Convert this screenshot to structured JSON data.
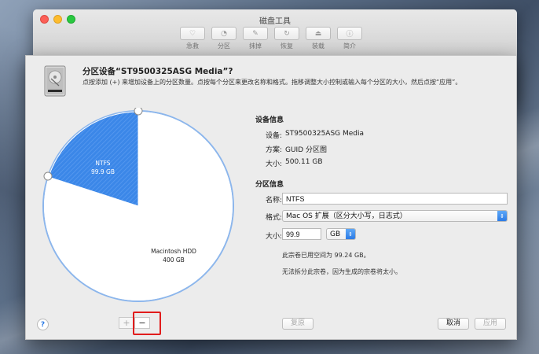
{
  "window": {
    "title": "磁盘工具",
    "toolbar": [
      {
        "label": "急救",
        "icon": "stethoscope-icon",
        "glyph": "♡"
      },
      {
        "label": "分区",
        "icon": "partition-icon",
        "glyph": "◔"
      },
      {
        "label": "抹掉",
        "icon": "erase-icon",
        "glyph": "✎"
      },
      {
        "label": "恢复",
        "icon": "restore-icon",
        "glyph": "↻"
      },
      {
        "label": "装载",
        "icon": "mount-icon",
        "glyph": "⏏"
      },
      {
        "label": "简介",
        "icon": "info-icon",
        "glyph": "ⓘ"
      }
    ]
  },
  "sheet": {
    "title": "分区设备“ST9500325ASG Media”?",
    "description": "点按添加 (+) 来增加设备上的分区数量。点按每个分区来更改名称和格式。拖移调整大小控制或输入每个分区的大小，然后点按“应用”。"
  },
  "pie": {
    "slices": [
      {
        "name": "NTFS",
        "size": "99.9 GB",
        "fraction": 0.2,
        "color": "#3b87e8"
      },
      {
        "name": "Macintosh HDD",
        "size": "400 GB",
        "fraction": 0.8,
        "color": "#ffffff"
      }
    ]
  },
  "device_info": {
    "title": "设备信息",
    "device_label": "设备:",
    "device_value": "ST9500325ASG Media",
    "scheme_label": "方案:",
    "scheme_value": "GUID 分区图",
    "size_label": "大小:",
    "size_value": "500.11 GB"
  },
  "partition_info": {
    "title": "分区信息",
    "name_label": "名称:",
    "name_value": "NTFS",
    "format_label": "格式:",
    "format_value": "Mac OS 扩展（区分大小写，日志式）",
    "size_label": "大小:",
    "size_value": "99.9",
    "unit_value": "GB",
    "note_used": "此宗卷已用空间为 99.24 GB。",
    "note_split": "无法拆分此宗卷，因为生成的宗卷将太小。"
  },
  "buttons": {
    "help": "?",
    "add": "+",
    "remove": "−",
    "revert": "复原",
    "cancel": "取消",
    "apply": "应用"
  },
  "colors": {
    "accent": "#3b87e8",
    "highlight": "#e11c1c"
  }
}
